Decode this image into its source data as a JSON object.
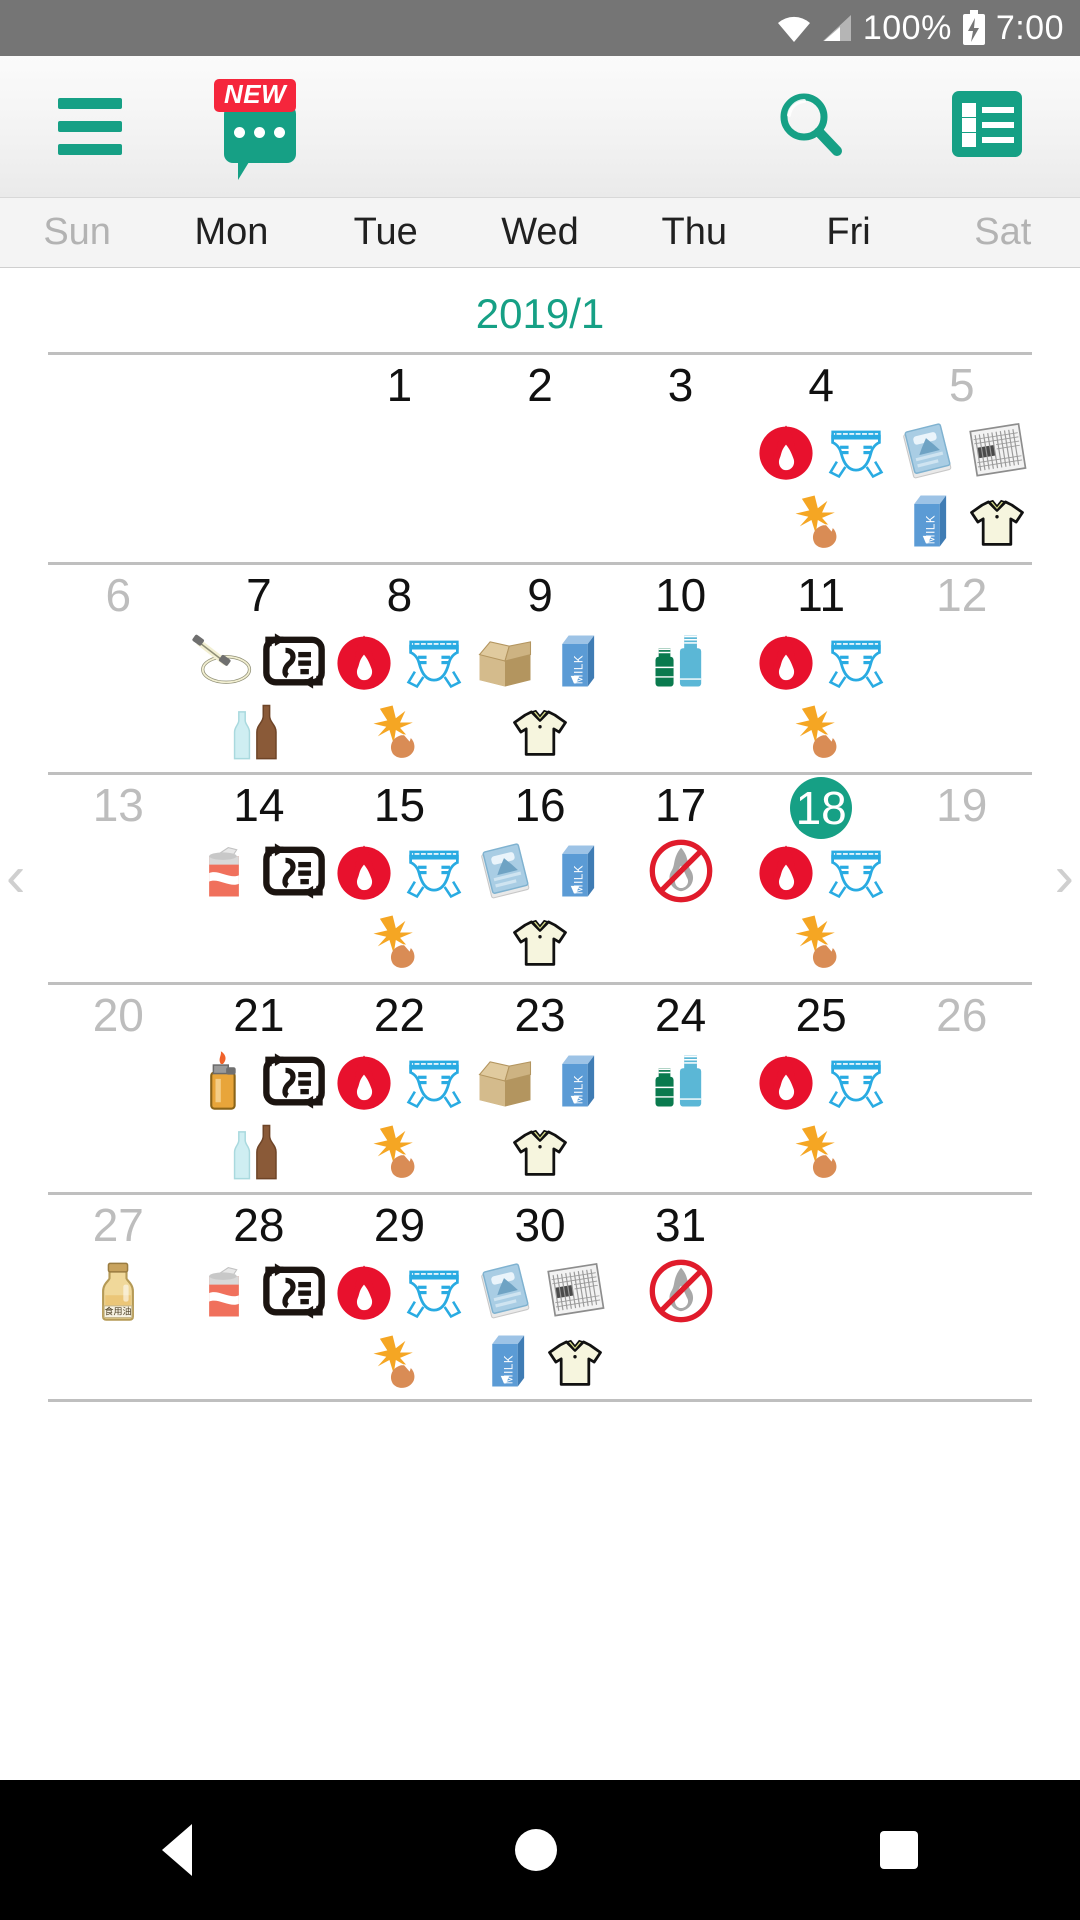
{
  "statusbar": {
    "wifi_icon": "wifi-icon",
    "signal_icon": "cellular-signal-icon",
    "battery_pct": "100%",
    "battery_icon": "battery-charging-icon",
    "time": "7:00"
  },
  "toolbar": {
    "menu_icon": "hamburger-menu-icon",
    "chat_icon": "chat-bubble-icon",
    "new_badge": "NEW",
    "search_icon": "search-icon",
    "list_icon": "list-view-icon",
    "accent_color": "#16a085",
    "badge_color": "#f5263c"
  },
  "weekdays": [
    {
      "label": "Sun",
      "dim": true
    },
    {
      "label": "Mon",
      "dim": false
    },
    {
      "label": "Tue",
      "dim": false
    },
    {
      "label": "Wed",
      "dim": false
    },
    {
      "label": "Thu",
      "dim": false
    },
    {
      "label": "Fri",
      "dim": false
    },
    {
      "label": "Sat",
      "dim": true
    }
  ],
  "month_label": "2019/1",
  "nav": {
    "prev": "‹",
    "next": "›"
  },
  "calendar": {
    "weeks": [
      [
        {
          "day": "",
          "dim": false,
          "selected": false,
          "icons": []
        },
        {
          "day": "",
          "dim": false,
          "selected": false,
          "icons": []
        },
        {
          "day": "1",
          "dim": false,
          "selected": false,
          "icons": []
        },
        {
          "day": "2",
          "dim": false,
          "selected": false,
          "icons": []
        },
        {
          "day": "3",
          "dim": false,
          "selected": false,
          "icons": []
        },
        {
          "day": "4",
          "dim": false,
          "selected": false,
          "icons": [
            "flame",
            "diaper",
            "leaf-acorn"
          ]
        },
        {
          "day": "5",
          "dim": true,
          "selected": false,
          "icons": [
            "book",
            "newspaper",
            "milk",
            "tshirt"
          ]
        }
      ],
      [
        {
          "day": "6",
          "dim": true,
          "selected": false,
          "icons": []
        },
        {
          "day": "7",
          "dim": false,
          "selected": false,
          "icons": [
            "fluorescent-tube",
            "plastic-recycle",
            "glass-bottles"
          ]
        },
        {
          "day": "8",
          "dim": false,
          "selected": false,
          "icons": [
            "flame",
            "diaper",
            "leaf-acorn"
          ]
        },
        {
          "day": "9",
          "dim": false,
          "selected": false,
          "icons": [
            "cardboard-box",
            "milk",
            "tshirt"
          ]
        },
        {
          "day": "10",
          "dim": false,
          "selected": false,
          "icons": [
            "pet-bottles"
          ]
        },
        {
          "day": "11",
          "dim": false,
          "selected": false,
          "icons": [
            "flame",
            "diaper",
            "leaf-acorn"
          ]
        },
        {
          "day": "12",
          "dim": true,
          "selected": false,
          "icons": []
        }
      ],
      [
        {
          "day": "13",
          "dim": true,
          "selected": false,
          "icons": []
        },
        {
          "day": "14",
          "dim": false,
          "selected": false,
          "icons": [
            "can",
            "plastic-recycle"
          ]
        },
        {
          "day": "15",
          "dim": false,
          "selected": false,
          "icons": [
            "flame",
            "diaper",
            "leaf-acorn"
          ]
        },
        {
          "day": "16",
          "dim": false,
          "selected": false,
          "icons": [
            "book",
            "milk",
            "tshirt"
          ]
        },
        {
          "day": "17",
          "dim": false,
          "selected": false,
          "icons": [
            "no-burn"
          ]
        },
        {
          "day": "18",
          "dim": false,
          "selected": true,
          "icons": [
            "flame",
            "diaper",
            "leaf-acorn"
          ]
        },
        {
          "day": "19",
          "dim": true,
          "selected": false,
          "icons": []
        }
      ],
      [
        {
          "day": "20",
          "dim": true,
          "selected": false,
          "icons": []
        },
        {
          "day": "21",
          "dim": false,
          "selected": false,
          "icons": [
            "lighter",
            "plastic-recycle",
            "glass-bottles"
          ]
        },
        {
          "day": "22",
          "dim": false,
          "selected": false,
          "icons": [
            "flame",
            "diaper",
            "leaf-acorn"
          ]
        },
        {
          "day": "23",
          "dim": false,
          "selected": false,
          "icons": [
            "cardboard-box",
            "milk",
            "tshirt"
          ]
        },
        {
          "day": "24",
          "dim": false,
          "selected": false,
          "icons": [
            "pet-bottles"
          ]
        },
        {
          "day": "25",
          "dim": false,
          "selected": false,
          "icons": [
            "flame",
            "diaper",
            "leaf-acorn"
          ]
        },
        {
          "day": "26",
          "dim": true,
          "selected": false,
          "icons": []
        }
      ],
      [
        {
          "day": "27",
          "dim": true,
          "selected": false,
          "icons": [
            "cooking-oil"
          ]
        },
        {
          "day": "28",
          "dim": false,
          "selected": false,
          "icons": [
            "can",
            "plastic-recycle"
          ]
        },
        {
          "day": "29",
          "dim": false,
          "selected": false,
          "icons": [
            "flame",
            "diaper",
            "leaf-acorn"
          ]
        },
        {
          "day": "30",
          "dim": false,
          "selected": false,
          "icons": [
            "book",
            "newspaper",
            "milk",
            "tshirt"
          ]
        },
        {
          "day": "31",
          "dim": false,
          "selected": false,
          "icons": [
            "no-burn"
          ]
        },
        {
          "day": "",
          "dim": false,
          "selected": false,
          "icons": []
        },
        {
          "day": "",
          "dim": false,
          "selected": false,
          "icons": []
        }
      ]
    ]
  },
  "icon_labels": {
    "flame": "burnable-garbage-icon",
    "no-burn": "no-burnable-garbage-icon",
    "diaper": "diaper-icon",
    "leaf-acorn": "leaf-acorn-icon",
    "book": "magazine-book-icon",
    "newspaper": "newspaper-icon",
    "milk": "milk-carton-icon",
    "tshirt": "tshirt-icon",
    "cardboard-box": "cardboard-box-icon",
    "pet-bottles": "pet-bottle-icon",
    "can": "aluminum-can-icon",
    "plastic-recycle": "plastic-recycle-mark-icon",
    "glass-bottles": "glass-bottle-icon",
    "fluorescent-tube": "fluorescent-tube-icon",
    "lighter": "lighter-icon",
    "cooking-oil": "cooking-oil-bottle-icon",
    "cooking_oil_text": "食用油",
    "milk_text": "MILK"
  },
  "bottomnav": {
    "back": "back-button",
    "home": "home-button",
    "recents": "recents-button"
  }
}
